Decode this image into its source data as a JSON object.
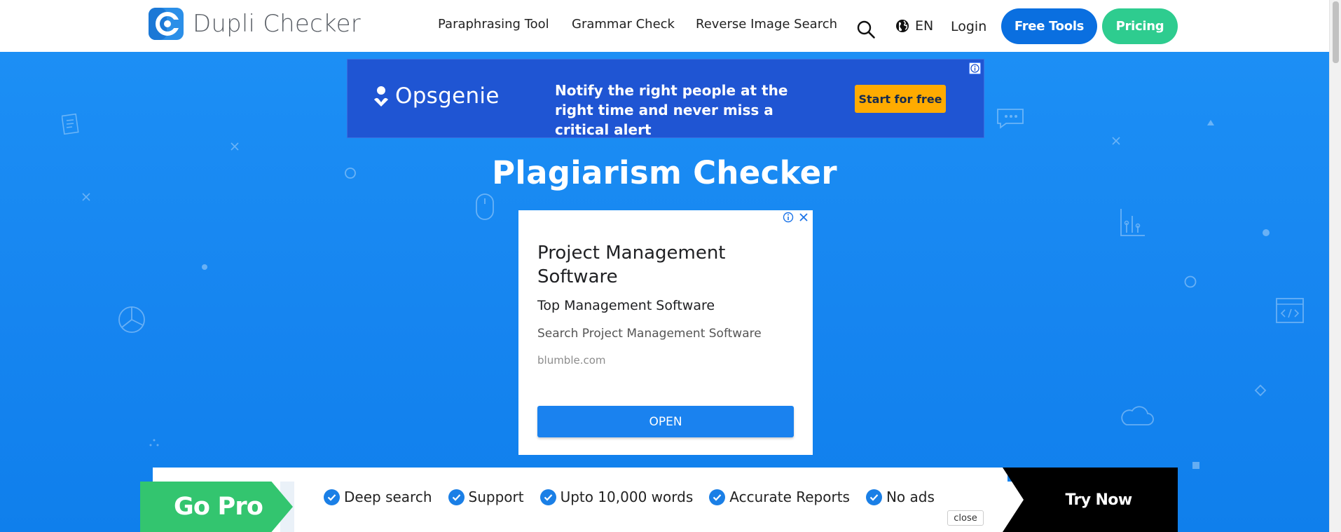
{
  "header": {
    "brand": "Dupli Checker",
    "nav": [
      {
        "label": "Paraphrasing Tool"
      },
      {
        "label": "Grammar Check"
      },
      {
        "label": "Reverse Image Search"
      }
    ],
    "language": "EN",
    "login": "Login",
    "free_tools": "Free Tools",
    "pricing": "Pricing"
  },
  "top_ad": {
    "brand": "Opsgenie",
    "message": "Notify the right people at the right time and never miss a critical alert",
    "cta": "Start for free"
  },
  "page_title": "Plagiarism Checker",
  "side_ad": {
    "headline": "Project Management Software",
    "subheadline": "Top Management Software",
    "description": "Search Project Management Software",
    "url": "blumble.com",
    "button": "OPEN"
  },
  "gopro": {
    "label": "Go Pro",
    "features": [
      "Deep search",
      "Support",
      "Upto 10,000 words",
      "Accurate Reports",
      "No ads"
    ],
    "close": "close",
    "cta": "Try Now"
  },
  "colors": {
    "brand_blue": "#0a6fe0",
    "brand_green": "#2ecc8f",
    "hero_blue": "#1685f0",
    "ad_blue": "#1f55d3",
    "ad_cta": "#ffab00"
  }
}
